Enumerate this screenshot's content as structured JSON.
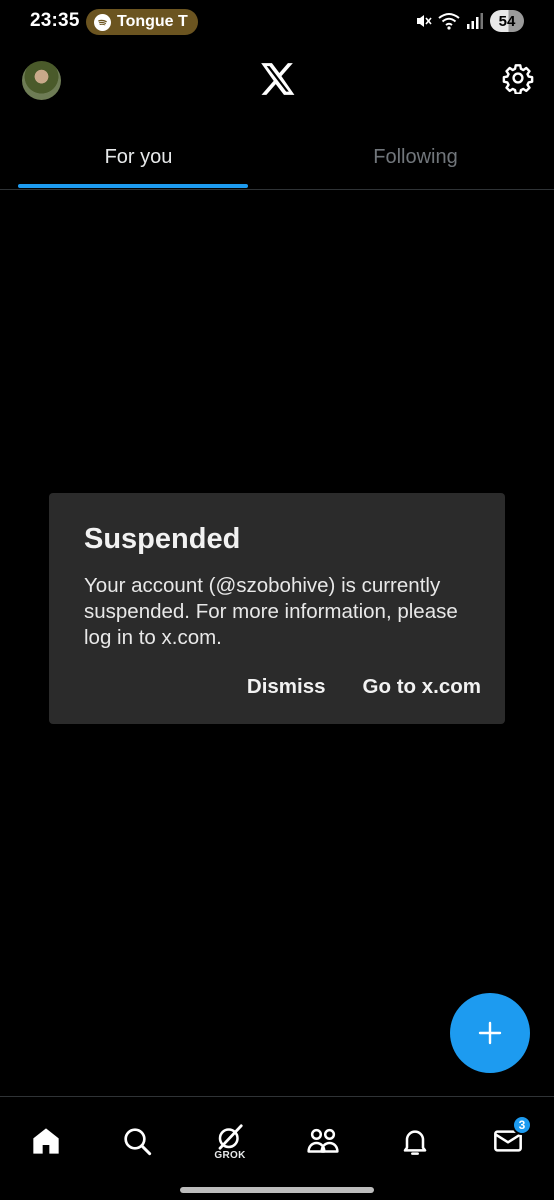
{
  "status_bar": {
    "time": "23:35",
    "media_text": "Tongue T",
    "media_app_icon": "spotify-icon",
    "battery": "54",
    "icons": [
      "mute-icon",
      "wifi-icon",
      "signal-icon",
      "battery-icon"
    ]
  },
  "header": {
    "avatar_icon": "avatar",
    "logo_icon": "x-logo-icon",
    "settings_icon": "gear-icon"
  },
  "tabs": [
    {
      "label": "For you",
      "active": true
    },
    {
      "label": "Following",
      "active": false
    }
  ],
  "dialog": {
    "title": "Suspended",
    "body": "Your account (@szobohive) is currently suspended. For more information, please log in to x.com.",
    "dismiss_label": "Dismiss",
    "goto_label": "Go to x.com"
  },
  "fab": {
    "icon": "plus-icon"
  },
  "bottom_nav": {
    "items": [
      {
        "icon": "home-icon"
      },
      {
        "icon": "search-icon"
      },
      {
        "icon": "grok-icon",
        "label": "GROK"
      },
      {
        "icon": "communities-icon"
      },
      {
        "icon": "bell-icon"
      },
      {
        "icon": "mail-icon",
        "badge": "3"
      }
    ]
  },
  "colors": {
    "accent": "#1d9bf0",
    "background": "#000000",
    "dialog_bg": "#2b2b2b",
    "inactive_tab": "#71767b"
  }
}
